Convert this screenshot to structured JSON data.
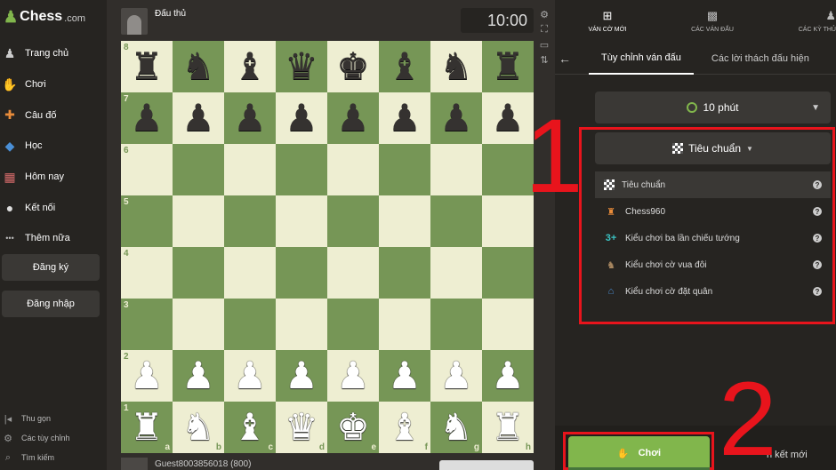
{
  "app": {
    "logo_name": "Chess",
    "logo_suffix": ".com",
    "logo_icon": "pawn-logo-icon",
    "accent_color": "#81b64c",
    "annotation_color": "#e8141c"
  },
  "sidebar": {
    "items": [
      {
        "label": "Trang chủ",
        "icon": "home-icon",
        "glyph": "♟"
      },
      {
        "label": "Chơi",
        "icon": "play-hand-icon",
        "glyph": "✋"
      },
      {
        "label": "Câu đố",
        "icon": "puzzle-icon",
        "glyph": "✚"
      },
      {
        "label": "Học",
        "icon": "learn-icon",
        "glyph": "◆"
      },
      {
        "label": "Hôm nay",
        "icon": "news-icon",
        "glyph": "▦"
      },
      {
        "label": "Kết nối",
        "icon": "social-icon",
        "glyph": "●"
      },
      {
        "label": "Thêm nữa",
        "icon": "more-icon",
        "glyph": "•••"
      }
    ],
    "signup_label": "Đăng ký",
    "login_label": "Đăng nhập",
    "bottom": [
      {
        "label": "Thu gọn",
        "icon": "collapse-icon",
        "glyph": "|◂"
      },
      {
        "label": "Các tùy chỉnh",
        "icon": "settings-gear-icon",
        "glyph": "⚙"
      },
      {
        "label": "Tìm kiếm",
        "icon": "search-icon",
        "glyph": "⌕"
      }
    ]
  },
  "game": {
    "opponent_name": "Đấu thủ",
    "opponent_clock": "10:00",
    "player_name": "Guest8003856018 (800)",
    "ranks": [
      "8",
      "7",
      "6",
      "5",
      "4",
      "3",
      "2",
      "1"
    ],
    "files": [
      "a",
      "b",
      "c",
      "d",
      "e",
      "f",
      "g",
      "h"
    ],
    "board": [
      [
        "bR",
        "bN",
        "bB",
        "bQ",
        "bK",
        "bB",
        "bN",
        "bR"
      ],
      [
        "bP",
        "bP",
        "bP",
        "bP",
        "bP",
        "bP",
        "bP",
        "bP"
      ],
      [
        "",
        "",
        "",
        "",
        "",
        "",
        "",
        ""
      ],
      [
        "",
        "",
        "",
        "",
        "",
        "",
        "",
        ""
      ],
      [
        "",
        "",
        "",
        "",
        "",
        "",
        "",
        ""
      ],
      [
        "",
        "",
        "",
        "",
        "",
        "",
        "",
        ""
      ],
      [
        "wP",
        "wP",
        "wP",
        "wP",
        "wP",
        "wP",
        "wP",
        "wP"
      ],
      [
        "wR",
        "wN",
        "wB",
        "wQ",
        "wK",
        "wB",
        "wN",
        "wR"
      ]
    ],
    "light_square_color": "#eeeed2",
    "dark_square_color": "#769656"
  },
  "board_tools": [
    "settings-gear-icon",
    "expand-icon",
    "screen-icon",
    "flip-icon"
  ],
  "panel": {
    "tabs": [
      {
        "label": "VÁN CỜ MỚI",
        "icon": "plus-icon",
        "glyph": "⊞"
      },
      {
        "label": "CÁC VÁN ĐẤU",
        "icon": "board-icon",
        "glyph": "▩"
      },
      {
        "label": "CÁC KỲ THỦ",
        "icon": "players-icon",
        "glyph": "♟"
      }
    ],
    "subtabs": [
      "Tùy chỉnh ván đấu",
      "Các lời thách đấu hiện"
    ],
    "time_control": "10 phút",
    "variant_selected": "Tiêu chuẩn",
    "variants": [
      {
        "label": "Tiêu chuẩn",
        "icon": "checker-icon",
        "glyph": "▩"
      },
      {
        "label": "Chess960",
        "icon": "chess960-icon",
        "glyph": "♜"
      },
      {
        "label": "Kiểu chơi ba lần chiếu tướng",
        "icon": "three-check-icon",
        "glyph": "3+"
      },
      {
        "label": "Kiểu chơi cờ vua đôi",
        "icon": "bughouse-icon",
        "glyph": "♞"
      },
      {
        "label": "Kiểu chơi cờ đặt quân",
        "icon": "crazyhouse-icon",
        "glyph": "⌂"
      }
    ],
    "play_label": "Chơi",
    "new_opponent_label": "n kết mới"
  },
  "annotations": {
    "one": "1",
    "two": "2"
  }
}
